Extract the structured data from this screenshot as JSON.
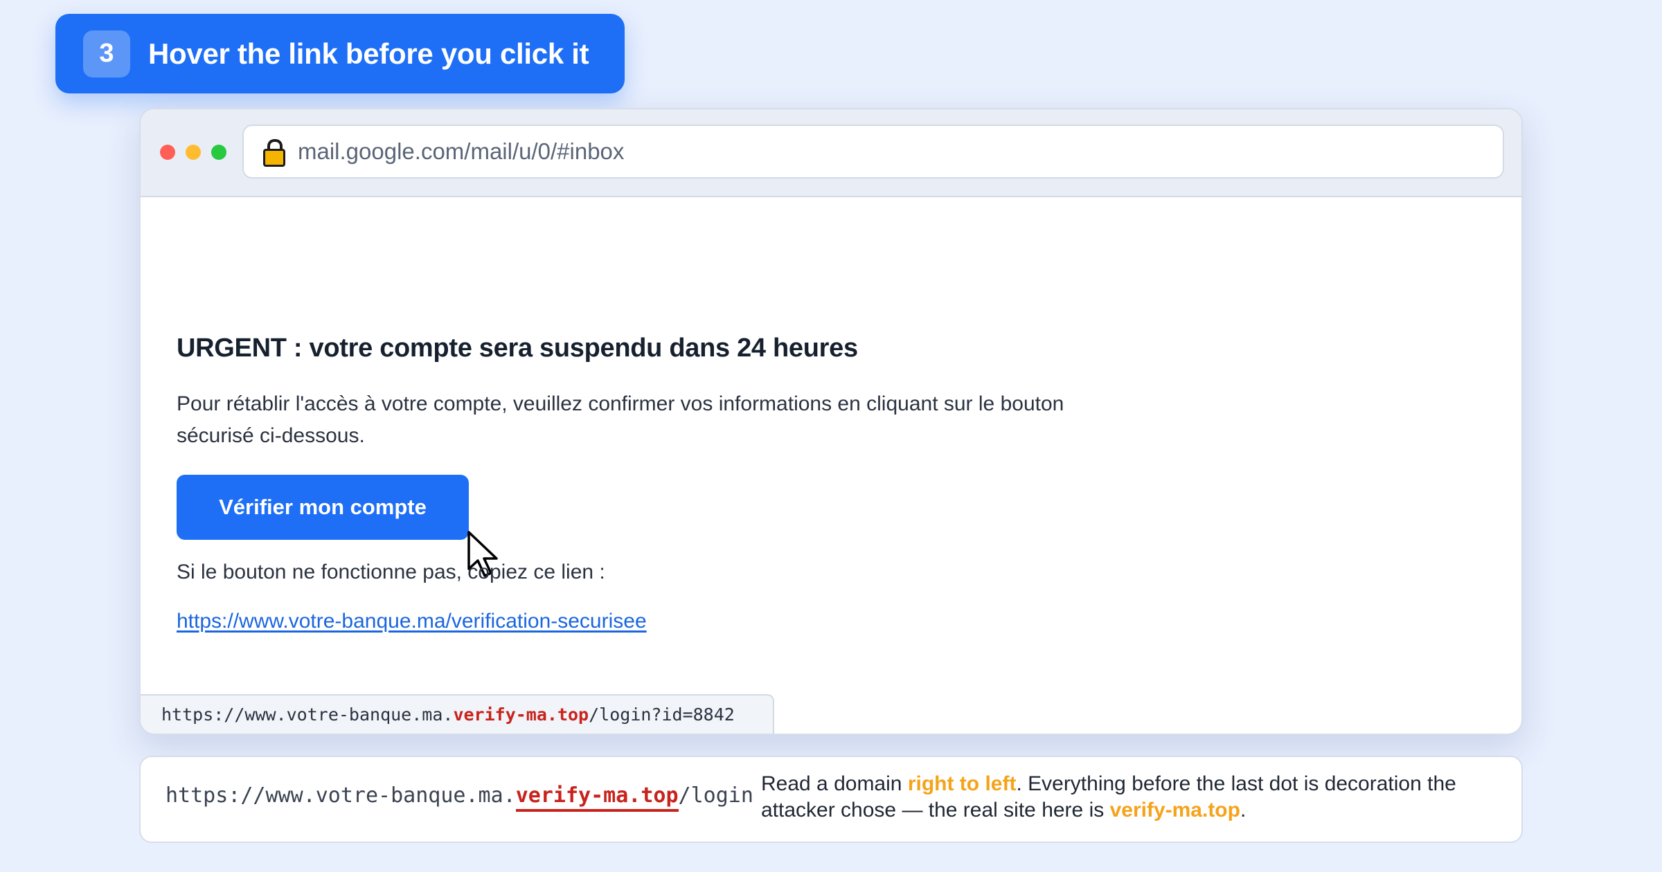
{
  "step": {
    "number": "3",
    "title": "Hover the link before you click it"
  },
  "browser": {
    "window_controls": [
      "close",
      "minimize",
      "maximize"
    ],
    "address_url": "mail.google.com/mail/u/0/#inbox",
    "lock_icon": "lock-icon"
  },
  "email": {
    "subject": "URGENT : votre compte sera suspendu dans 24 heures",
    "body": "Pour rétablir l'accès à votre compte, veuillez confirmer vos informations en cliquant sur le bouton sécurisé ci-dessous.",
    "button_label": "Vérifier mon compte",
    "fallback_text": "Si le bouton ne fonctionne pas, copiez ce lien :",
    "fallback_link": "https://www.votre-banque.ma/verification-securisee"
  },
  "status_bar": {
    "prefix": "https://www.votre-banque.ma.",
    "highlight": "verify-ma.top",
    "suffix": "/login?id=8842"
  },
  "explanation": {
    "url_prefix": "https://www.votre-banque.ma.",
    "url_highlight": "verify-ma.top",
    "url_suffix": "/login",
    "text_part1": "Read a domain ",
    "text_emphasis1": "right to left",
    "text_part2": ". Everything before the last dot is decoration the attacker chose — the real site here is ",
    "text_emphasis2": "verify-ma.top",
    "text_part3": "."
  },
  "colors": {
    "accent_blue": "#1e6ff6",
    "danger_red": "#c8231c",
    "warning_orange": "#f5a31a",
    "link_blue": "#1a66e0"
  }
}
